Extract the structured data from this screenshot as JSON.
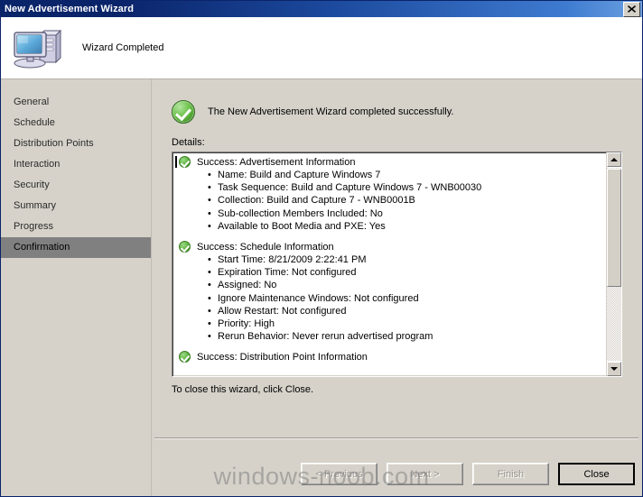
{
  "window": {
    "title": "New Advertisement Wizard",
    "close_label": "✕"
  },
  "banner": {
    "title": "Wizard Completed",
    "icon": "computer-icon"
  },
  "sidebar": {
    "items": [
      {
        "label": "General",
        "active": false
      },
      {
        "label": "Schedule",
        "active": false
      },
      {
        "label": "Distribution Points",
        "active": false
      },
      {
        "label": "Interaction",
        "active": false
      },
      {
        "label": "Security",
        "active": false
      },
      {
        "label": "Summary",
        "active": false
      },
      {
        "label": "Progress",
        "active": false
      },
      {
        "label": "Confirmation",
        "active": true
      }
    ]
  },
  "main": {
    "success_message": "The New Advertisement Wizard completed successfully.",
    "details_label": "Details:",
    "close_hint": "To close this wizard, click Close.",
    "details": [
      {
        "heading": "Success: Advertisement Information",
        "items": [
          "Name: Build and Capture Windows 7",
          "Task Sequence: Build and Capture Windows 7 - WNB00030",
          "Collection: Build and Capture 7 - WNB0001B",
          "Sub-collection Members Included: No",
          "Available to Boot Media and PXE: Yes"
        ]
      },
      {
        "heading": "Success: Schedule Information",
        "items": [
          "Start Time: 8/21/2009 2:22:41 PM",
          "Expiration Time: Not configured",
          "Assigned: No",
          "Ignore Maintenance Windows: Not configured",
          "Allow Restart: Not configured",
          "Priority: High",
          "Rerun Behavior: Never rerun advertised program"
        ]
      },
      {
        "heading": "Success: Distribution Point Information",
        "items": []
      }
    ]
  },
  "footer": {
    "buttons": [
      {
        "label": "< Previous",
        "state": "disabled"
      },
      {
        "label": "Next >",
        "state": "disabled"
      },
      {
        "label": "Finish",
        "state": "disabled"
      },
      {
        "label": "Close",
        "state": "default"
      }
    ]
  },
  "watermark": {
    "text": "windows-noob.com"
  }
}
